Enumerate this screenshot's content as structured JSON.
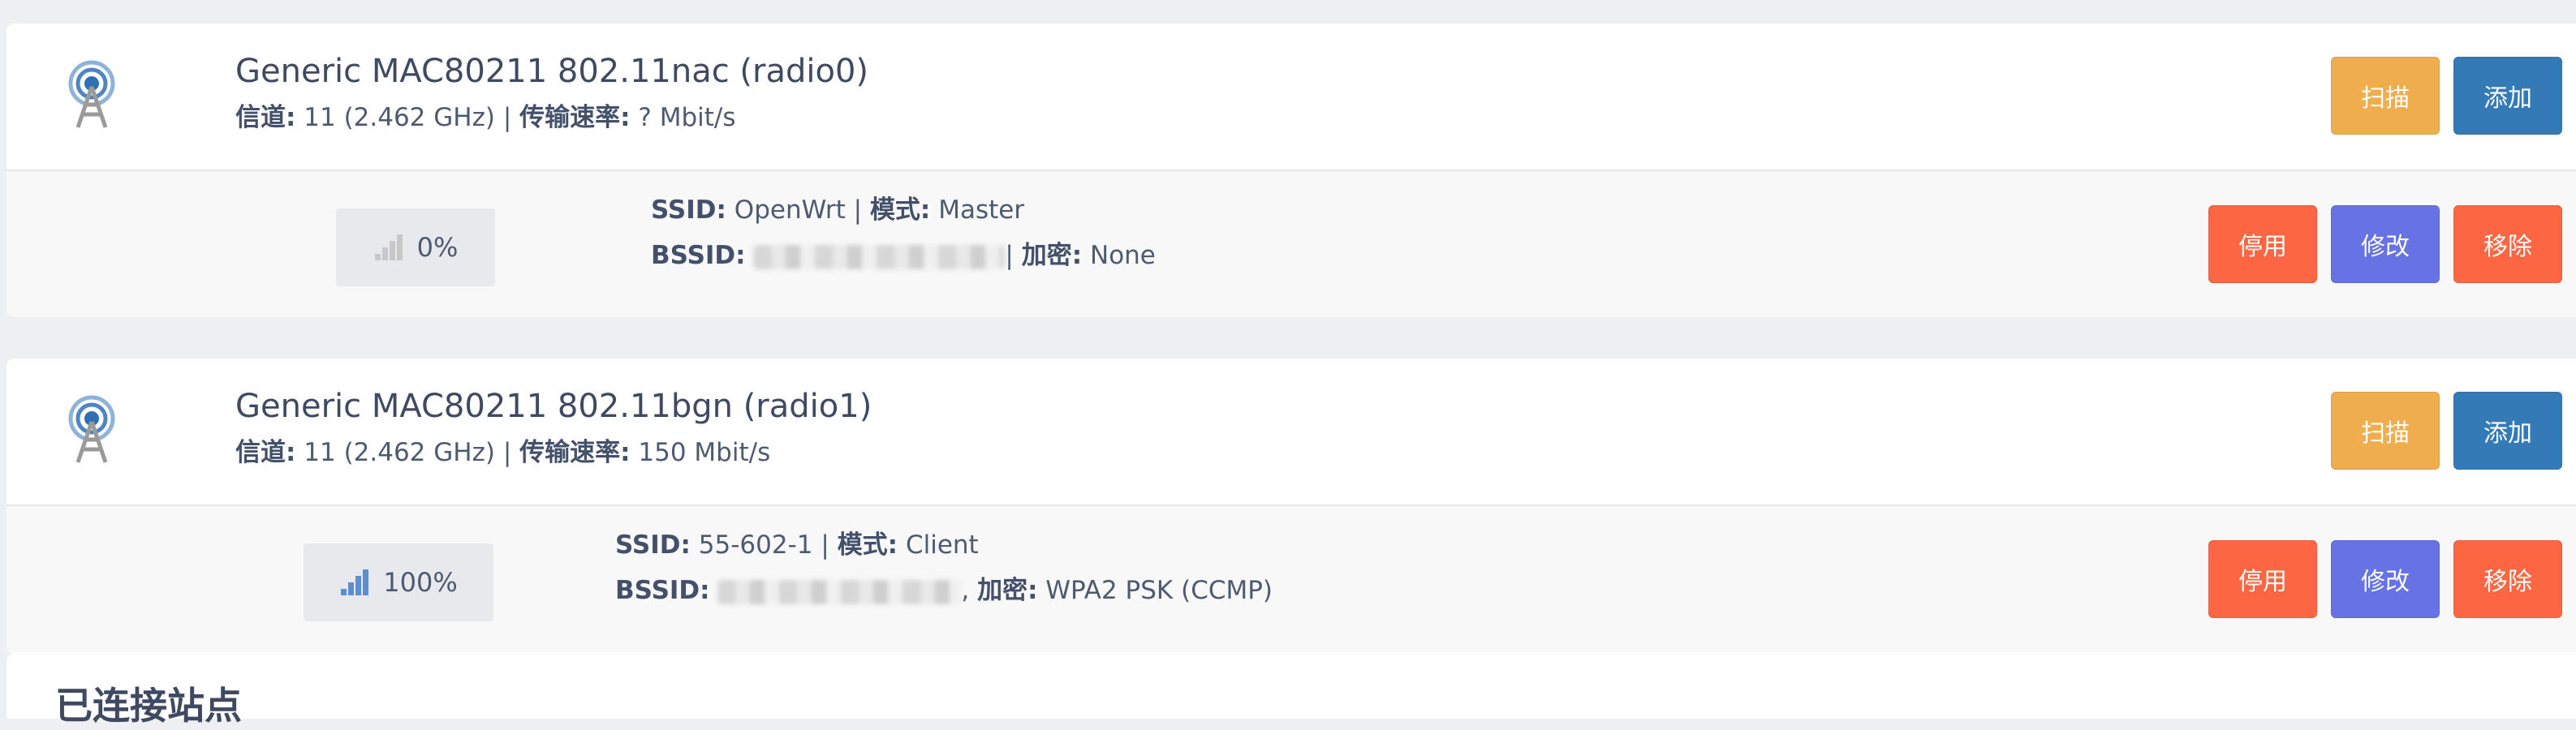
{
  "devices": [
    {
      "name": "Generic MAC80211 802.11nac (radio0)",
      "channel_label": "信道:",
      "channel_value": "11 (2.462 GHz)",
      "rate_label": "传输速率:",
      "rate_value": "? Mbit/s",
      "scan_label": "扫描",
      "add_label": "添加",
      "icon": "radio-antenna-icon",
      "iface": {
        "signal_percent": "0%",
        "signal_level": 0,
        "ssid_label": "SSID:",
        "ssid_value": "OpenWrt",
        "mode_label": "模式:",
        "mode_value": "Master",
        "bssid_label": "BSSID:",
        "enc_label": "加密:",
        "enc_value": "None",
        "disable_label": "停用",
        "edit_label": "修改",
        "remove_label": "移除"
      }
    },
    {
      "name": "Generic MAC80211 802.11bgn (radio1)",
      "channel_label": "信道:",
      "channel_value": "11 (2.462 GHz)",
      "rate_label": "传输速率:",
      "rate_value": "150 Mbit/s",
      "scan_label": "扫描",
      "add_label": "添加",
      "icon": "radio-antenna-icon",
      "iface": {
        "signal_percent": "100%",
        "signal_level": 1.0,
        "ssid_label": "SSID:",
        "ssid_value": "55-602-1",
        "mode_label": "模式:",
        "mode_value": "Client",
        "bssid_label": "BSSID:",
        "enc_label": "加密:",
        "enc_value": "WPA2 PSK (CCMP)",
        "disable_label": "停用",
        "edit_label": "修改",
        "remove_label": "移除"
      }
    }
  ],
  "next_section_title": "已连接站点",
  "colors": {
    "scan": "#f0ad4e",
    "add": "#337ab7",
    "disable": "#fd6642",
    "edit": "#6772e5",
    "remove": "#fd6642"
  }
}
